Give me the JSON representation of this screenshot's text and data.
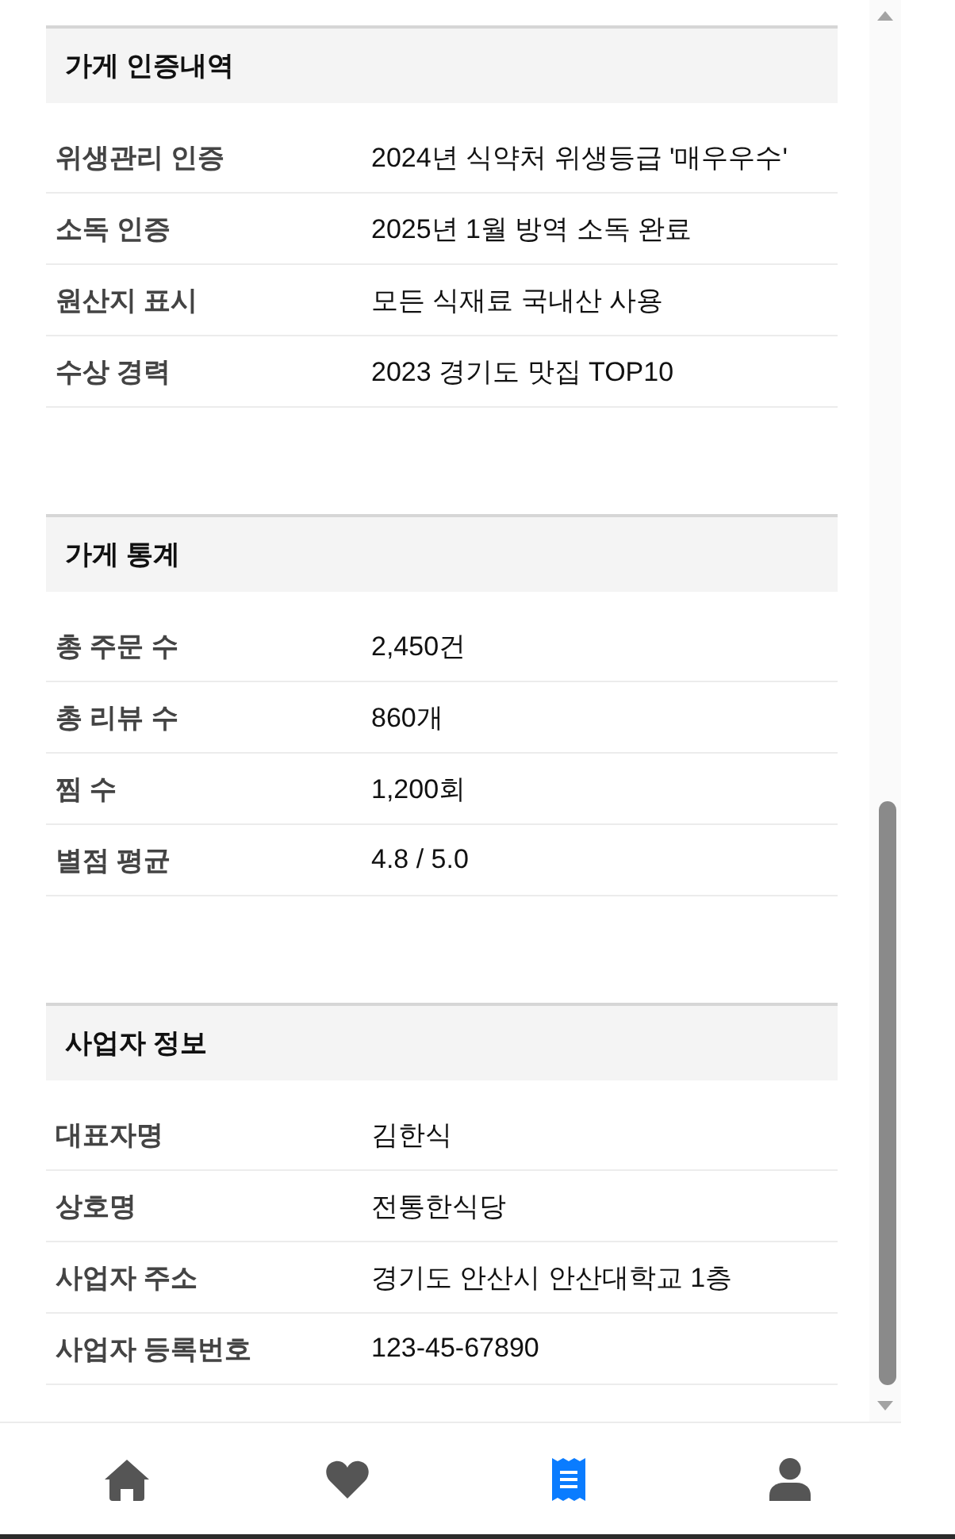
{
  "sections": [
    {
      "title": "가게 인증내역",
      "rows": [
        {
          "label": "위생관리 인증",
          "value": "2024년 식약처 위생등급 '매우우수'"
        },
        {
          "label": "소독 인증",
          "value": "2025년 1월 방역 소독 완료"
        },
        {
          "label": "원산지 표시",
          "value": "모든 식재료 국내산 사용"
        },
        {
          "label": "수상 경력",
          "value": "2023 경기도 맛집 TOP10"
        }
      ]
    },
    {
      "title": "가게 통계",
      "rows": [
        {
          "label": "총 주문 수",
          "value": "2,450건"
        },
        {
          "label": "총 리뷰 수",
          "value": "860개"
        },
        {
          "label": "찜 수",
          "value": "1,200회"
        },
        {
          "label": "별점 평균",
          "value": "4.8 / 5.0"
        }
      ]
    },
    {
      "title": "사업자 정보",
      "rows": [
        {
          "label": "대표자명",
          "value": "김한식"
        },
        {
          "label": "상호명",
          "value": "전통한식당"
        },
        {
          "label": "사업자 주소",
          "value": "경기도 안산시 안산대학교 1층"
        },
        {
          "label": "사업자 등록번호",
          "value": "123-45-67890"
        }
      ]
    }
  ],
  "bottom_nav": [
    {
      "selected": false
    },
    {
      "selected": false
    },
    {
      "selected": true
    },
    {
      "selected": false
    }
  ]
}
